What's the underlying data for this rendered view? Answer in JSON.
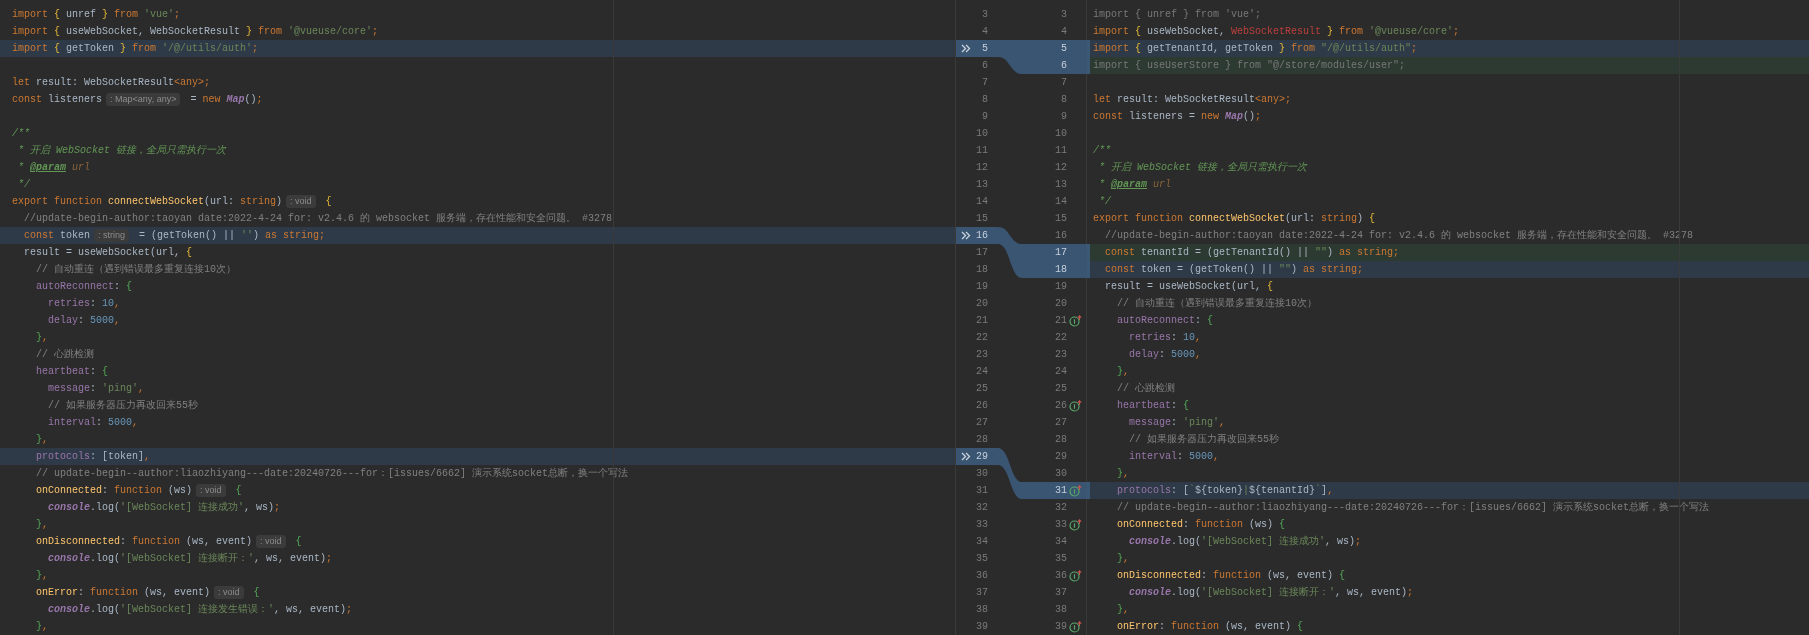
{
  "rows": [
    {
      "left_number": "3",
      "right_number": "3",
      "merge_arrow": false,
      "gutter_icon": false,
      "left": {
        "modified": false,
        "added": false,
        "tokens": [
          {
            "kind": "kw",
            "text": "import "
          },
          {
            "kind": "brace",
            "text": "{"
          },
          {
            "kind": "p",
            "text": " unref "
          },
          {
            "kind": "brace",
            "text": "}"
          },
          {
            "kind": "kw",
            "text": " from "
          },
          {
            "kind": "str",
            "text": "'vue'"
          },
          {
            "kind": "kw",
            "text": ";"
          }
        ]
      },
      "right": {
        "modified": false,
        "added": false,
        "tokens": [
          {
            "kind": "unused",
            "text": "import { unref } from 'vue';"
          }
        ]
      }
    },
    {
      "left_number": "4",
      "right_number": "4",
      "merge_arrow": false,
      "gutter_icon": false,
      "left": {
        "modified": false,
        "added": false,
        "tokens": [
          {
            "kind": "kw",
            "text": "import "
          },
          {
            "kind": "brace",
            "text": "{"
          },
          {
            "kind": "p",
            "text": " useWebSocket, WebSocketResult "
          },
          {
            "kind": "brace",
            "text": "}"
          },
          {
            "kind": "kw",
            "text": " from "
          },
          {
            "kind": "str",
            "text": "'@vueuse/core'"
          },
          {
            "kind": "kw",
            "text": ";"
          }
        ]
      },
      "right": {
        "modified": false,
        "added": false,
        "tokens": [
          {
            "kind": "kw",
            "text": "import "
          },
          {
            "kind": "brace",
            "text": "{"
          },
          {
            "kind": "p",
            "text": " useWebSocket, "
          },
          {
            "kind": "err",
            "text": "WebSocketResult"
          },
          {
            "kind": "brace",
            "text": " }"
          },
          {
            "kind": "kw",
            "text": " from "
          },
          {
            "kind": "str",
            "text": "'@vueuse/core'"
          },
          {
            "kind": "kw",
            "text": ";"
          }
        ]
      }
    },
    {
      "left_number": "5",
      "right_number": "5",
      "merge_arrow": true,
      "gutter_icon": false,
      "left": {
        "modified": true,
        "added": false,
        "tokens": [
          {
            "kind": "kw",
            "text": "import "
          },
          {
            "kind": "brace",
            "text": "{"
          },
          {
            "kind": "p",
            "text": " getToken "
          },
          {
            "kind": "brace",
            "text": "}"
          },
          {
            "kind": "kw",
            "text": " from "
          },
          {
            "kind": "str",
            "text": "'/@/utils/auth'"
          },
          {
            "kind": "kw",
            "text": ";"
          }
        ]
      },
      "right": {
        "modified": true,
        "added": false,
        "tokens": [
          {
            "kind": "kw",
            "text": "import "
          },
          {
            "kind": "brace",
            "text": "{"
          },
          {
            "kind": "p",
            "text": " getTenantId, getToken "
          },
          {
            "kind": "brace",
            "text": "}"
          },
          {
            "kind": "kw",
            "text": " from "
          },
          {
            "kind": "str",
            "text": "\"/@/utils/auth\""
          },
          {
            "kind": "kw",
            "text": ";"
          }
        ]
      }
    },
    {
      "left_number": "6",
      "right_number": "6",
      "merge_arrow": false,
      "gutter_icon": false,
      "left": {
        "modified": false,
        "added": false
      },
      "right": {
        "modified": false,
        "added": true,
        "tokens": [
          {
            "kind": "unused",
            "text": "import { useUserStore } from \"@/store/modules/user\";"
          }
        ]
      }
    },
    {
      "left_number": "7",
      "right_number": "7",
      "merge_arrow": false,
      "gutter_icon": false,
      "left": {
        "modified": false,
        "added": false,
        "tokens": [
          {
            "kind": "kw",
            "text": "let "
          },
          {
            "kind": "p",
            "text": "result: WebSocketResult"
          },
          {
            "kind": "kw",
            "text": "<any>;"
          }
        ]
      },
      "right": {
        "modified": false,
        "added": false
      }
    },
    {
      "left_number": "8",
      "right_number": "8",
      "merge_arrow": false,
      "gutter_icon": false,
      "left": {
        "modified": false,
        "added": false,
        "tokens": [
          {
            "kind": "kw",
            "text": "const "
          },
          {
            "kind": "p",
            "text": "listeners"
          },
          {
            "kind": "hint",
            "text": ": Map<any, any>"
          },
          {
            "kind": "p",
            "text": " = "
          },
          {
            "kind": "kw",
            "text": "new "
          },
          {
            "kind": "cls",
            "text": "Map"
          },
          {
            "kind": "p",
            "text": "()"
          },
          {
            "kind": "kw",
            "text": ";"
          }
        ]
      },
      "right": {
        "modified": false,
        "added": false,
        "tokens": [
          {
            "kind": "kw",
            "text": "let "
          },
          {
            "kind": "p",
            "text": "result: WebSocketResult"
          },
          {
            "kind": "kw",
            "text": "<any>;"
          }
        ]
      }
    },
    {
      "left_number": "9",
      "right_number": "9",
      "merge_arrow": false,
      "gutter_icon": false,
      "left": {
        "modified": false,
        "added": false
      },
      "right": {
        "modified": false,
        "added": false,
        "tokens": [
          {
            "kind": "kw",
            "text": "const "
          },
          {
            "kind": "p",
            "text": "listeners = "
          },
          {
            "kind": "kw",
            "text": "new "
          },
          {
            "kind": "cls",
            "text": "Map"
          },
          {
            "kind": "p",
            "text": "()"
          },
          {
            "kind": "kw",
            "text": ";"
          }
        ]
      }
    },
    {
      "left_number": "10",
      "right_number": "10",
      "merge_arrow": false,
      "gutter_icon": false,
      "left": {
        "modified": false,
        "added": false,
        "tokens": [
          {
            "kind": "doc",
            "text": "/**"
          }
        ]
      },
      "right": {
        "modified": false,
        "added": false
      }
    },
    {
      "left_number": "11",
      "right_number": "11",
      "merge_arrow": false,
      "gutter_icon": false,
      "left": {
        "modified": false,
        "added": false,
        "tokens": [
          {
            "kind": "doc",
            "text": " * 开启 WebSocket 链接，全局只需执行一次"
          }
        ]
      },
      "right": {
        "modified": false,
        "added": false,
        "tokens": [
          {
            "kind": "doc",
            "text": "/**"
          }
        ]
      }
    },
    {
      "left_number": "12",
      "right_number": "12",
      "merge_arrow": false,
      "gutter_icon": false,
      "left": {
        "modified": false,
        "added": false,
        "tokens": [
          {
            "kind": "doc",
            "text": " * "
          },
          {
            "kind": "doctag",
            "text": "@param"
          },
          {
            "kind": "param",
            "text": " url"
          }
        ]
      },
      "right": {
        "modified": false,
        "added": false,
        "tokens": [
          {
            "kind": "doc",
            "text": " * 开启 WebSocket 链接，全局只需执行一次"
          }
        ]
      }
    },
    {
      "left_number": "13",
      "right_number": "13",
      "merge_arrow": false,
      "gutter_icon": false,
      "left": {
        "modified": false,
        "added": false,
        "tokens": [
          {
            "kind": "doc",
            "text": " */"
          }
        ]
      },
      "right": {
        "modified": false,
        "added": false,
        "tokens": [
          {
            "kind": "doc",
            "text": " * "
          },
          {
            "kind": "doctag",
            "text": "@param"
          },
          {
            "kind": "param",
            "text": " url"
          }
        ]
      }
    },
    {
      "left_number": "14",
      "right_number": "14",
      "merge_arrow": false,
      "gutter_icon": false,
      "left": {
        "modified": false,
        "added": false,
        "tokens": [
          {
            "kind": "kw",
            "text": "export function "
          },
          {
            "kind": "fn",
            "text": "connectWebSocket"
          },
          {
            "kind": "p",
            "text": "(url: "
          },
          {
            "kind": "kw",
            "text": "string"
          },
          {
            "kind": "p",
            "text": ")"
          },
          {
            "kind": "hint",
            "text": ": void"
          },
          {
            "kind": "brace",
            "text": " {"
          }
        ]
      },
      "right": {
        "modified": false,
        "added": false,
        "tokens": [
          {
            "kind": "doc",
            "text": " */"
          }
        ]
      }
    },
    {
      "left_number": "15",
      "right_number": "15",
      "merge_arrow": false,
      "gutter_icon": false,
      "left": {
        "modified": false,
        "added": false,
        "tokens": [
          {
            "kind": "com",
            "text": "  //update-begin-author:taoyan date:2022-4-24 for: v2.4.6 的 websocket 服务端，存在性能和安全问题。 #3278"
          }
        ]
      },
      "right": {
        "modified": false,
        "added": false,
        "tokens": [
          {
            "kind": "kw",
            "text": "export function "
          },
          {
            "kind": "fn",
            "text": "connectWebSocket"
          },
          {
            "kind": "p",
            "text": "(url: "
          },
          {
            "kind": "kw",
            "text": "string"
          },
          {
            "kind": "p",
            "text": ") "
          },
          {
            "kind": "brace",
            "text": "{"
          }
        ]
      }
    },
    {
      "left_number": "16",
      "right_number": "16",
      "merge_arrow": true,
      "gutter_icon": false,
      "left": {
        "modified": true,
        "added": false,
        "tokens": [
          {
            "kind": "kw",
            "text": "  const "
          },
          {
            "kind": "p",
            "text": "token"
          },
          {
            "kind": "hint",
            "text": ": string"
          },
          {
            "kind": "p",
            "text": " = (getToken() || "
          },
          {
            "kind": "str",
            "text": "''"
          },
          {
            "kind": "p",
            "text": ") "
          },
          {
            "kind": "kw",
            "text": "as string;"
          }
        ]
      },
      "right": {
        "modified": false,
        "added": false,
        "tokens": [
          {
            "kind": "com",
            "text": "  //update-begin-author:taoyan date:2022-4-24 for: v2.4.6 的 websocket 服务端，存在性能和安全问题。 #3278"
          }
        ]
      }
    },
    {
      "left_number": "17",
      "right_number": "17",
      "merge_arrow": false,
      "gutter_icon": false,
      "left": {
        "modified": false,
        "added": false,
        "tokens": [
          {
            "kind": "p",
            "text": "  result = useWebSocket(url, "
          },
          {
            "kind": "brace",
            "text": "{"
          }
        ]
      },
      "right": {
        "modified": false,
        "added": true,
        "tokens": [
          {
            "kind": "kw",
            "text": "  const "
          },
          {
            "kind": "p",
            "text": "tenantId = (getTenantId() || "
          },
          {
            "kind": "str",
            "text": "\"\""
          },
          {
            "kind": "p",
            "text": ") "
          },
          {
            "kind": "kw",
            "text": "as string;"
          }
        ]
      }
    },
    {
      "left_number": "18",
      "right_number": "18",
      "merge_arrow": false,
      "gutter_icon": false,
      "left": {
        "modified": false,
        "added": false,
        "tokens": [
          {
            "kind": "com",
            "text": "    // 自动重连（遇到错误最多重复连接10次）"
          }
        ]
      },
      "right": {
        "modified": true,
        "added": false,
        "tokens": [
          {
            "kind": "kw",
            "text": "  const "
          },
          {
            "kind": "p",
            "text": "token = (getToken() || "
          },
          {
            "kind": "str",
            "text": "\"\""
          },
          {
            "kind": "p",
            "text": ") "
          },
          {
            "kind": "kw",
            "text": "as string;"
          }
        ]
      }
    },
    {
      "left_number": "19",
      "right_number": "19",
      "merge_arrow": false,
      "gutter_icon": false,
      "left": {
        "modified": false,
        "added": false,
        "tokens": [
          {
            "kind": "prop",
            "text": "    autoReconnect"
          },
          {
            "kind": "p",
            "text": ": "
          },
          {
            "kind": "brace2",
            "text": "{"
          }
        ]
      },
      "right": {
        "modified": false,
        "added": false,
        "tokens": [
          {
            "kind": "p",
            "text": "  result = useWebSocket(url, "
          },
          {
            "kind": "brace",
            "text": "{"
          }
        ]
      }
    },
    {
      "left_number": "20",
      "right_number": "20",
      "merge_arrow": false,
      "gutter_icon": false,
      "left": {
        "modified": false,
        "added": false,
        "tokens": [
          {
            "kind": "prop",
            "text": "      retries"
          },
          {
            "kind": "p",
            "text": ": "
          },
          {
            "kind": "num",
            "text": "10"
          },
          {
            "kind": "kw",
            "text": ","
          }
        ]
      },
      "right": {
        "modified": false,
        "added": false,
        "tokens": [
          {
            "kind": "com",
            "text": "    // 自动重连（遇到错误最多重复连接10次）"
          }
        ]
      }
    },
    {
      "left_number": "21",
      "right_number": "21",
      "merge_arrow": false,
      "gutter_icon": true,
      "left": {
        "modified": false,
        "added": false,
        "tokens": [
          {
            "kind": "prop",
            "text": "      delay"
          },
          {
            "kind": "p",
            "text": ": "
          },
          {
            "kind": "num",
            "text": "5000"
          },
          {
            "kind": "kw",
            "text": ","
          }
        ]
      },
      "right": {
        "modified": false,
        "added": false,
        "tokens": [
          {
            "kind": "prop",
            "text": "    autoReconnect"
          },
          {
            "kind": "p",
            "text": ": "
          },
          {
            "kind": "brace2",
            "text": "{"
          }
        ]
      }
    },
    {
      "left_number": "22",
      "right_number": "22",
      "merge_arrow": false,
      "gutter_icon": false,
      "left": {
        "modified": false,
        "added": false,
        "tokens": [
          {
            "kind": "brace2",
            "text": "    }"
          },
          {
            "kind": "kw",
            "text": ","
          }
        ]
      },
      "right": {
        "modified": false,
        "added": false,
        "tokens": [
          {
            "kind": "prop",
            "text": "      retries"
          },
          {
            "kind": "p",
            "text": ": "
          },
          {
            "kind": "num",
            "text": "10"
          },
          {
            "kind": "kw",
            "text": ","
          }
        ]
      }
    },
    {
      "left_number": "23",
      "right_number": "23",
      "merge_arrow": false,
      "gutter_icon": false,
      "left": {
        "modified": false,
        "added": false,
        "tokens": [
          {
            "kind": "com",
            "text": "    // 心跳检测"
          }
        ]
      },
      "right": {
        "modified": false,
        "added": false,
        "tokens": [
          {
            "kind": "prop",
            "text": "      delay"
          },
          {
            "kind": "p",
            "text": ": "
          },
          {
            "kind": "num",
            "text": "5000"
          },
          {
            "kind": "kw",
            "text": ","
          }
        ]
      }
    },
    {
      "left_number": "24",
      "right_number": "24",
      "merge_arrow": false,
      "gutter_icon": false,
      "left": {
        "modified": false,
        "added": false,
        "tokens": [
          {
            "kind": "prop",
            "text": "    heartbeat"
          },
          {
            "kind": "p",
            "text": ": "
          },
          {
            "kind": "brace2",
            "text": "{"
          }
        ]
      },
      "right": {
        "modified": false,
        "added": false,
        "tokens": [
          {
            "kind": "brace2",
            "text": "    }"
          },
          {
            "kind": "kw",
            "text": ","
          }
        ]
      }
    },
    {
      "left_number": "25",
      "right_number": "25",
      "merge_arrow": false,
      "gutter_icon": false,
      "left": {
        "modified": false,
        "added": false,
        "tokens": [
          {
            "kind": "prop",
            "text": "      message"
          },
          {
            "kind": "p",
            "text": ": "
          },
          {
            "kind": "str",
            "text": "'ping'"
          },
          {
            "kind": "kw",
            "text": ","
          }
        ]
      },
      "right": {
        "modified": false,
        "added": false,
        "tokens": [
          {
            "kind": "com",
            "text": "    // 心跳检测"
          }
        ]
      }
    },
    {
      "left_number": "26",
      "right_number": "26",
      "merge_arrow": false,
      "gutter_icon": true,
      "left": {
        "modified": false,
        "added": false,
        "tokens": [
          {
            "kind": "com",
            "text": "      // 如果服务器压力再改回来55秒"
          }
        ]
      },
      "right": {
        "modified": false,
        "added": false,
        "tokens": [
          {
            "kind": "prop",
            "text": "    heartbeat"
          },
          {
            "kind": "p",
            "text": ": "
          },
          {
            "kind": "brace2",
            "text": "{"
          }
        ]
      }
    },
    {
      "left_number": "27",
      "right_number": "27",
      "merge_arrow": false,
      "gutter_icon": false,
      "left": {
        "modified": false,
        "added": false,
        "tokens": [
          {
            "kind": "prop",
            "text": "      interval"
          },
          {
            "kind": "p",
            "text": ": "
          },
          {
            "kind": "num",
            "text": "5000"
          },
          {
            "kind": "kw",
            "text": ","
          }
        ]
      },
      "right": {
        "modified": false,
        "added": false,
        "tokens": [
          {
            "kind": "prop",
            "text": "      message"
          },
          {
            "kind": "p",
            "text": ": "
          },
          {
            "kind": "str",
            "text": "'ping'"
          },
          {
            "kind": "kw",
            "text": ","
          }
        ]
      }
    },
    {
      "left_number": "28",
      "right_number": "28",
      "merge_arrow": false,
      "gutter_icon": false,
      "left": {
        "modified": false,
        "added": false,
        "tokens": [
          {
            "kind": "brace2",
            "text": "    }"
          },
          {
            "kind": "kw",
            "text": ","
          }
        ]
      },
      "right": {
        "modified": false,
        "added": false,
        "tokens": [
          {
            "kind": "com",
            "text": "      // 如果服务器压力再改回来55秒"
          }
        ]
      }
    },
    {
      "left_number": "29",
      "right_number": "29",
      "merge_arrow": true,
      "gutter_icon": false,
      "left": {
        "modified": true,
        "added": false,
        "tokens": [
          {
            "kind": "prop",
            "text": "    protocols"
          },
          {
            "kind": "p",
            "text": ": [token]"
          },
          {
            "kind": "kw",
            "text": ","
          }
        ]
      },
      "right": {
        "modified": false,
        "added": false,
        "tokens": [
          {
            "kind": "prop",
            "text": "      interval"
          },
          {
            "kind": "p",
            "text": ": "
          },
          {
            "kind": "num",
            "text": "5000"
          },
          {
            "kind": "kw",
            "text": ","
          }
        ]
      }
    },
    {
      "left_number": "30",
      "right_number": "30",
      "merge_arrow": false,
      "gutter_icon": false,
      "left": {
        "modified": false,
        "added": false,
        "tokens": [
          {
            "kind": "com",
            "text": "    // update-begin--author:liaozhiyang---date:20240726---for：[issues/6662] 演示系统socket总断，换一个写法"
          }
        ]
      },
      "right": {
        "modified": false,
        "added": false,
        "tokens": [
          {
            "kind": "brace2",
            "text": "    }"
          },
          {
            "kind": "kw",
            "text": ","
          }
        ]
      }
    },
    {
      "left_number": "31",
      "right_number": "31",
      "merge_arrow": false,
      "gutter_icon": true,
      "left": {
        "modified": false,
        "added": false,
        "tokens": [
          {
            "kind": "fn",
            "text": "    onConnected"
          },
          {
            "kind": "p",
            "text": ": "
          },
          {
            "kind": "kw",
            "text": "function "
          },
          {
            "kind": "p",
            "text": "(ws)"
          },
          {
            "kind": "hint",
            "text": ": void"
          },
          {
            "kind": "brace2",
            "text": " {"
          }
        ]
      },
      "right": {
        "modified": true,
        "added": false,
        "tokens": [
          {
            "kind": "prop",
            "text": "    protocols"
          },
          {
            "kind": "p",
            "text": ": ["
          },
          {
            "kind": "str",
            "text": "`"
          },
          {
            "kind": "p",
            "text": "${token}"
          },
          {
            "kind": "str",
            "text": "|"
          },
          {
            "kind": "p",
            "text": "${tenantId}"
          },
          {
            "kind": "str",
            "text": "`"
          },
          {
            "kind": "p",
            "text": "]"
          },
          {
            "kind": "kw",
            "text": ","
          }
        ]
      }
    },
    {
      "left_number": "32",
      "right_number": "32",
      "merge_arrow": false,
      "gutter_icon": false,
      "left": {
        "modified": false,
        "added": false,
        "tokens": [
          {
            "kind": "glob",
            "text": "      console"
          },
          {
            "kind": "p",
            "text": ".log("
          },
          {
            "kind": "str",
            "text": "'[WebSocket] 连接成功'"
          },
          {
            "kind": "p",
            "text": ", ws)"
          },
          {
            "kind": "kw",
            "text": ";"
          }
        ]
      },
      "right": {
        "modified": false,
        "added": false,
        "tokens": [
          {
            "kind": "com",
            "text": "    // update-begin--author:liaozhiyang---date:20240726---for：[issues/6662] 演示系统socket总断，换一个写法"
          }
        ]
      }
    },
    {
      "left_number": "33",
      "right_number": "33",
      "merge_arrow": false,
      "gutter_icon": true,
      "left": {
        "modified": false,
        "added": false,
        "tokens": [
          {
            "kind": "brace2",
            "text": "    }"
          },
          {
            "kind": "kw",
            "text": ","
          }
        ]
      },
      "right": {
        "modified": false,
        "added": false,
        "tokens": [
          {
            "kind": "fn",
            "text": "    onConnected"
          },
          {
            "kind": "p",
            "text": ": "
          },
          {
            "kind": "kw",
            "text": "function "
          },
          {
            "kind": "p",
            "text": "(ws) "
          },
          {
            "kind": "brace2",
            "text": "{"
          }
        ]
      }
    },
    {
      "left_number": "34",
      "right_number": "34",
      "merge_arrow": false,
      "gutter_icon": false,
      "left": {
        "modified": false,
        "added": false,
        "tokens": [
          {
            "kind": "fn",
            "text": "    onDisconnected"
          },
          {
            "kind": "p",
            "text": ": "
          },
          {
            "kind": "kw",
            "text": "function "
          },
          {
            "kind": "p",
            "text": "(ws, event)"
          },
          {
            "kind": "hint",
            "text": ": void"
          },
          {
            "kind": "brace2",
            "text": " {"
          }
        ]
      },
      "right": {
        "modified": false,
        "added": false,
        "tokens": [
          {
            "kind": "glob",
            "text": "      console"
          },
          {
            "kind": "p",
            "text": ".log("
          },
          {
            "kind": "str",
            "text": "'[WebSocket] 连接成功'"
          },
          {
            "kind": "p",
            "text": ", ws)"
          },
          {
            "kind": "kw",
            "text": ";"
          }
        ]
      }
    },
    {
      "left_number": "35",
      "right_number": "35",
      "merge_arrow": false,
      "gutter_icon": false,
      "left": {
        "modified": false,
        "added": false,
        "tokens": [
          {
            "kind": "glob",
            "text": "      console"
          },
          {
            "kind": "p",
            "text": ".log("
          },
          {
            "kind": "str",
            "text": "'[WebSocket] 连接断开：'"
          },
          {
            "kind": "p",
            "text": ", ws, event)"
          },
          {
            "kind": "kw",
            "text": ";"
          }
        ]
      },
      "right": {
        "modified": false,
        "added": false,
        "tokens": [
          {
            "kind": "brace2",
            "text": "    }"
          },
          {
            "kind": "kw",
            "text": ","
          }
        ]
      }
    },
    {
      "left_number": "36",
      "right_number": "36",
      "merge_arrow": false,
      "gutter_icon": true,
      "left": {
        "modified": false,
        "added": false,
        "tokens": [
          {
            "kind": "brace2",
            "text": "    }"
          },
          {
            "kind": "kw",
            "text": ","
          }
        ]
      },
      "right": {
        "modified": false,
        "added": false,
        "tokens": [
          {
            "kind": "fn",
            "text": "    onDisconnected"
          },
          {
            "kind": "p",
            "text": ": "
          },
          {
            "kind": "kw",
            "text": "function "
          },
          {
            "kind": "p",
            "text": "(ws, event) "
          },
          {
            "kind": "brace2",
            "text": "{"
          }
        ]
      }
    },
    {
      "left_number": "37",
      "right_number": "37",
      "merge_arrow": false,
      "gutter_icon": false,
      "left": {
        "modified": false,
        "added": false,
        "tokens": [
          {
            "kind": "fn",
            "text": "    onError"
          },
          {
            "kind": "p",
            "text": ": "
          },
          {
            "kind": "kw",
            "text": "function "
          },
          {
            "kind": "p",
            "text": "(ws, event)"
          },
          {
            "kind": "hint",
            "text": ": void"
          },
          {
            "kind": "brace2",
            "text": " {"
          }
        ]
      },
      "right": {
        "modified": false,
        "added": false,
        "tokens": [
          {
            "kind": "glob",
            "text": "      console"
          },
          {
            "kind": "p",
            "text": ".log("
          },
          {
            "kind": "str",
            "text": "'[WebSocket] 连接断开：'"
          },
          {
            "kind": "p",
            "text": ", ws, event)"
          },
          {
            "kind": "kw",
            "text": ";"
          }
        ]
      }
    },
    {
      "left_number": "38",
      "right_number": "38",
      "merge_arrow": false,
      "gutter_icon": false,
      "left": {
        "modified": false,
        "added": false,
        "tokens": [
          {
            "kind": "glob",
            "text": "      console"
          },
          {
            "kind": "p",
            "text": ".log("
          },
          {
            "kind": "str",
            "text": "'[WebSocket] 连接发生错误：'"
          },
          {
            "kind": "p",
            "text": ", ws, event)"
          },
          {
            "kind": "kw",
            "text": ";"
          }
        ]
      },
      "right": {
        "modified": false,
        "added": false,
        "tokens": [
          {
            "kind": "brace2",
            "text": "    }"
          },
          {
            "kind": "kw",
            "text": ","
          }
        ]
      }
    },
    {
      "left_number": "39",
      "right_number": "39",
      "merge_arrow": false,
      "gutter_icon": true,
      "left": {
        "modified": false,
        "added": false,
        "tokens": [
          {
            "kind": "brace2",
            "text": "    }"
          },
          {
            "kind": "kw",
            "text": ","
          }
        ]
      },
      "right": {
        "modified": false,
        "added": false,
        "tokens": [
          {
            "kind": "fn",
            "text": "    onError"
          },
          {
            "kind": "p",
            "text": ": "
          },
          {
            "kind": "kw",
            "text": "function "
          },
          {
            "kind": "p",
            "text": "(ws, event) "
          },
          {
            "kind": "brace2",
            "text": "{"
          }
        ]
      }
    }
  ]
}
